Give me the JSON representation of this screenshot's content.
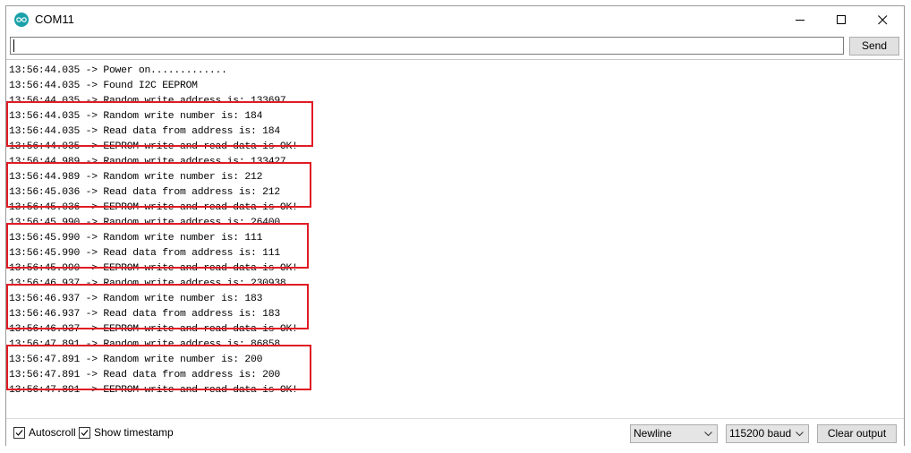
{
  "window": {
    "title": "COM11"
  },
  "send": {
    "input_value": "",
    "button_label": "Send"
  },
  "output": {
    "lines": [
      "13:56:44.035 -> Power on.............",
      "13:56:44.035 -> Found I2C EEPROM",
      "13:56:44.035 -> Random write address is: 133697",
      "13:56:44.035 -> Random write number is: 184",
      "13:56:44.035 -> Read data from address is: 184",
      "13:56:44.035 -> EEPROM write and read data is OK!",
      "13:56:44.989 -> Random write address is: 133427",
      "13:56:44.989 -> Random write number is: 212",
      "13:56:45.036 -> Read data from address is: 212",
      "13:56:45.036 -> EEPROM write and read data is OK!",
      "13:56:45.990 -> Random write address is: 26400",
      "13:56:45.990 -> Random write number is: 111",
      "13:56:45.990 -> Read data from address is: 111",
      "13:56:45.990 -> EEPROM write and read data is OK!",
      "13:56:46.937 -> Random write address is: 230938",
      "13:56:46.937 -> Random write number is: 183",
      "13:56:46.937 -> Read data from address is: 183",
      "13:56:46.937 -> EEPROM write and read data is OK!",
      "13:56:47.891 -> Random write address is: 86858",
      "13:56:47.891 -> Random write number is: 200",
      "13:56:47.891 -> Read data from address is: 200",
      "13:56:47.891 -> EEPROM write and read data is OK!"
    ],
    "highlight_color": "#e01b24"
  },
  "footer": {
    "autoscroll": {
      "label": "Autoscroll",
      "checked": true
    },
    "show_timestamp": {
      "label": "Show timestamp",
      "checked": true
    },
    "line_ending": "Newline",
    "baud_rate": "115200 baud",
    "clear_label": "Clear output"
  },
  "icons": {
    "app": "arduino-logo-icon",
    "minimize": "minimize-icon",
    "maximize": "maximize-icon",
    "close": "close-icon"
  }
}
